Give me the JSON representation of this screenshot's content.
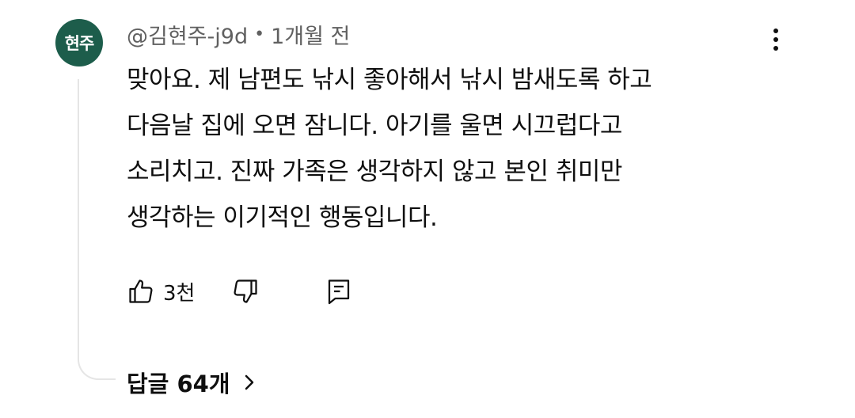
{
  "comment": {
    "avatar_text": "현주",
    "handle": "@김현주-j9d",
    "separator": "•",
    "time": "1개월 전",
    "lines": [
      "맞아요. 제 남편도 낚시 좋아해서 낚시 밤새도록 하고",
      "다음날 집에 오면 잠니다. 아기를 울면 시끄럽다고",
      "소리치고. 진짜 가족은 생각하지 않고 본인 취미만",
      "생각하는 이기적인 행동입니다."
    ],
    "like_count": "3천",
    "replies_label": "답글 64개"
  },
  "icons": {
    "more": "more-vert-icon",
    "like": "thumbs-up-icon",
    "dislike": "thumbs-down-icon",
    "reply": "reply-comment-icon",
    "expand": "chevron-right-icon"
  },
  "colors": {
    "avatar_bg": "#1d5d4b",
    "meta_text": "#606060",
    "text": "#0f0f0f",
    "thread_line": "#e5e5e5"
  }
}
